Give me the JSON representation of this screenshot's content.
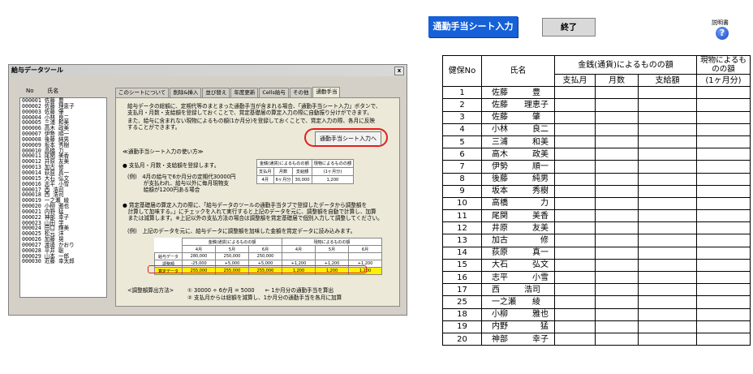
{
  "dialog": {
    "title": "給与データツール",
    "close_label": "x",
    "list_headers": [
      "No",
      "氏名"
    ],
    "employees": [
      "000001 佐藤 豊",
      "000002 佐藤 理恵子",
      "000003 佐藤 肇",
      "000004 小林 良二",
      "000005 三浦 和美",
      "000006 高木 政美",
      "000007 伊勢 順一",
      "000008 後藤 純男",
      "000009 坂本 秀樹",
      "000010 高橋 力",
      "000011 尾関 美香",
      "000012 井原 友美",
      "000013 加古 修",
      "000014 荻原 真一",
      "000015 大石 弘文",
      "000016 志平 小雪",
      "000017 西 浩司",
      "000018 西 浩司",
      "000019 一之瀬 綾",
      "000020 小柳 雅也",
      "000021 内野 猛",
      "000022 神部 幸子",
      "000023 山田 学",
      "000024 田口 輝美",
      "000025 松元 洋",
      "000026 加藤 晃",
      "000027 渡邊 かおり",
      "000028 平井 聡",
      "000029 山本 一郎",
      "000030 近藤 幸太郎"
    ],
    "tabs": [
      "このシートについて",
      "削除&挿入",
      "並び替え",
      "年度更新",
      "Cells給与",
      "その他",
      "通勤手当"
    ],
    "active_tab_index": 6,
    "panel": {
      "intro_lines": [
        "給与データの総額に、定期代等のまとまった通勤手当が含まれる場合、「通勤手当シート入力」ボタンで、",
        "支払月・月数・支給額を登録しておくことで、賞定基礎届の算定入力の際に自動振り分けができます。",
        "また、給与に含まれない現物によるもの額(1か月分)を登録しておくことで、賞定入力の際、各月に反映",
        "することができます。"
      ],
      "open_button": "通勤手当シート入力へ",
      "howto_title": "≪通勤手当シート入力の使い方≫",
      "step1": "● 支払月・月数・支給額を登録します。",
      "example1_lines": [
        "(例)　4月の給与で6か月分の定期代30000円",
        "　　　が支払われ、給与以外に毎月現物支",
        "　　　給額が1200円ある場合"
      ],
      "mini_table": {
        "header_money": "金銭(通貨)によるものの額",
        "header_goods": "現物によるものの額",
        "cols": [
          "支払月",
          "月数",
          "支給額",
          "(1ヶ月分)"
        ],
        "row": [
          "4月",
          "6ヶ月分",
          "30,000",
          "1,200"
        ]
      },
      "step2_lines": [
        "● 賞定基礎届の算定入力の際に、「給与データのツールの通勤手当タブで登録したデータから調整額を",
        "　計算して加味する。」にチェックを入れて実行すると上記のデータを元に、調整額を自動で計算し、加算",
        "　または減算します。※上記以外の支払方法の場合は調整額を賞定基礎届で個別入力して調整してください。"
      ],
      "example2": "(例)　上記のデータを元に、給与データに調整額を加味した金額を賞定データに読み込みます。",
      "example_table": {
        "header_money": "金銭(通貨)によるものの額",
        "header_goods": "現物によるものの額",
        "months": [
          "4月",
          "5月",
          "6月",
          "4月",
          "5月",
          "6月"
        ],
        "rows": [
          {
            "label": "給与データ",
            "values": [
              "280,000",
              "250,000",
              "250,000",
              "",
              "",
              ""
            ]
          },
          {
            "label": "調整額",
            "values": [
              "-25,000",
              "+5,000",
              "+5,000",
              "+1,200",
              "+1,200",
              "+1,200"
            ]
          },
          {
            "label": "算定データ",
            "values": [
              "255,000",
              "255,000",
              "255,000",
              "1,200",
              "1,200",
              "1,200"
            ]
          }
        ]
      },
      "calc_label": "<調整額算出方法>",
      "calc_lines": [
        "① 30000 ÷ 6か月 = 5000　　← 1か月分の通勤手当を算出",
        "② 支払月からは総額を減算し、1か月分の通勤手当を各月に加算"
      ]
    }
  },
  "sheet_buttons": {
    "start": "通勤手当シート入力",
    "end": "終了",
    "help_label": "説明書",
    "help_icon": "?"
  },
  "sheet": {
    "headers": {
      "no": "健保No",
      "name": "氏名",
      "money": "金銭(通貨)によるものの額",
      "goods": "現物によるものの額",
      "pay_month": "支払月",
      "months": "月数",
      "amount": "支給額",
      "per_month": "(1ヶ月分)"
    },
    "rows": [
      {
        "no": "1",
        "name": "佐藤　　　豊"
      },
      {
        "no": "2",
        "name": "佐藤　　理恵子"
      },
      {
        "no": "3",
        "name": "佐藤　　　肇"
      },
      {
        "no": "4",
        "name": "小林　　　良二"
      },
      {
        "no": "5",
        "name": "三浦　　　和美"
      },
      {
        "no": "6",
        "name": "高木　　　政美"
      },
      {
        "no": "7",
        "name": "伊勢　　　順一"
      },
      {
        "no": "8",
        "name": "後藤　　　純男"
      },
      {
        "no": "9",
        "name": "坂本　　　秀樹"
      },
      {
        "no": "10",
        "name": "高橋　　　　力"
      },
      {
        "no": "11",
        "name": "尾関　　　美香"
      },
      {
        "no": "12",
        "name": "井原　　　友美"
      },
      {
        "no": "13",
        "name": "加古　　　　修"
      },
      {
        "no": "14",
        "name": "荻原　　　真一"
      },
      {
        "no": "15",
        "name": "大石　　　弘文"
      },
      {
        "no": "16",
        "name": "志平　　　小雪"
      },
      {
        "no": "17",
        "name": "西　　　浩司"
      },
      {
        "no": "25",
        "name": "一之瀬　　綾"
      },
      {
        "no": "18",
        "name": "小柳　　　雅也"
      },
      {
        "no": "19",
        "name": "内野　　　　猛"
      },
      {
        "no": "20",
        "name": "神部　　　幸子"
      }
    ]
  }
}
